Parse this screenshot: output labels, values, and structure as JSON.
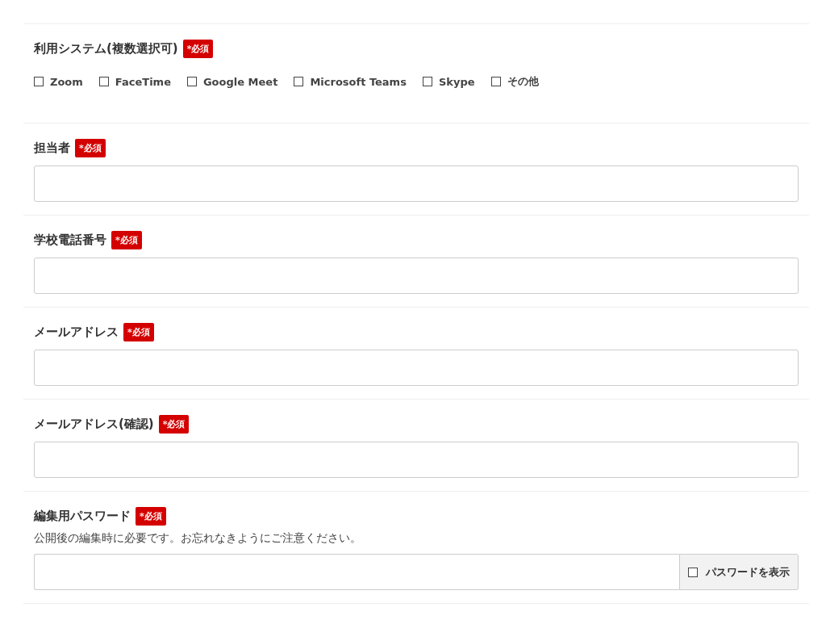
{
  "fields": [
    {
      "kind": "checkboxes",
      "label": "利用システム(複数選択可)",
      "badge": "*必須",
      "options": [
        {
          "label": "Zoom",
          "checked": false
        },
        {
          "label": "FaceTime",
          "checked": false
        },
        {
          "label": "Google Meet",
          "checked": false
        },
        {
          "label": "Microsoft Teams",
          "checked": false
        },
        {
          "label": "Skype",
          "checked": false
        },
        {
          "label": "その他",
          "checked": false
        }
      ]
    },
    {
      "kind": "text",
      "label": "担当者",
      "badge": "*必須"
    },
    {
      "kind": "text",
      "label": "学校電話番号",
      "badge": "*必須"
    },
    {
      "kind": "text",
      "label": "メールアドレス",
      "badge": "*必須"
    },
    {
      "kind": "text",
      "label": "メールアドレス(確認)",
      "badge": "*必須"
    },
    {
      "kind": "password",
      "label": "編集用パスワード",
      "badge": "*必須",
      "note": "公開後の編集時に必要です。お忘れなきようにご注意ください。",
      "toggle": {
        "label": "パスワードを表示",
        "checked": false
      }
    }
  ]
}
